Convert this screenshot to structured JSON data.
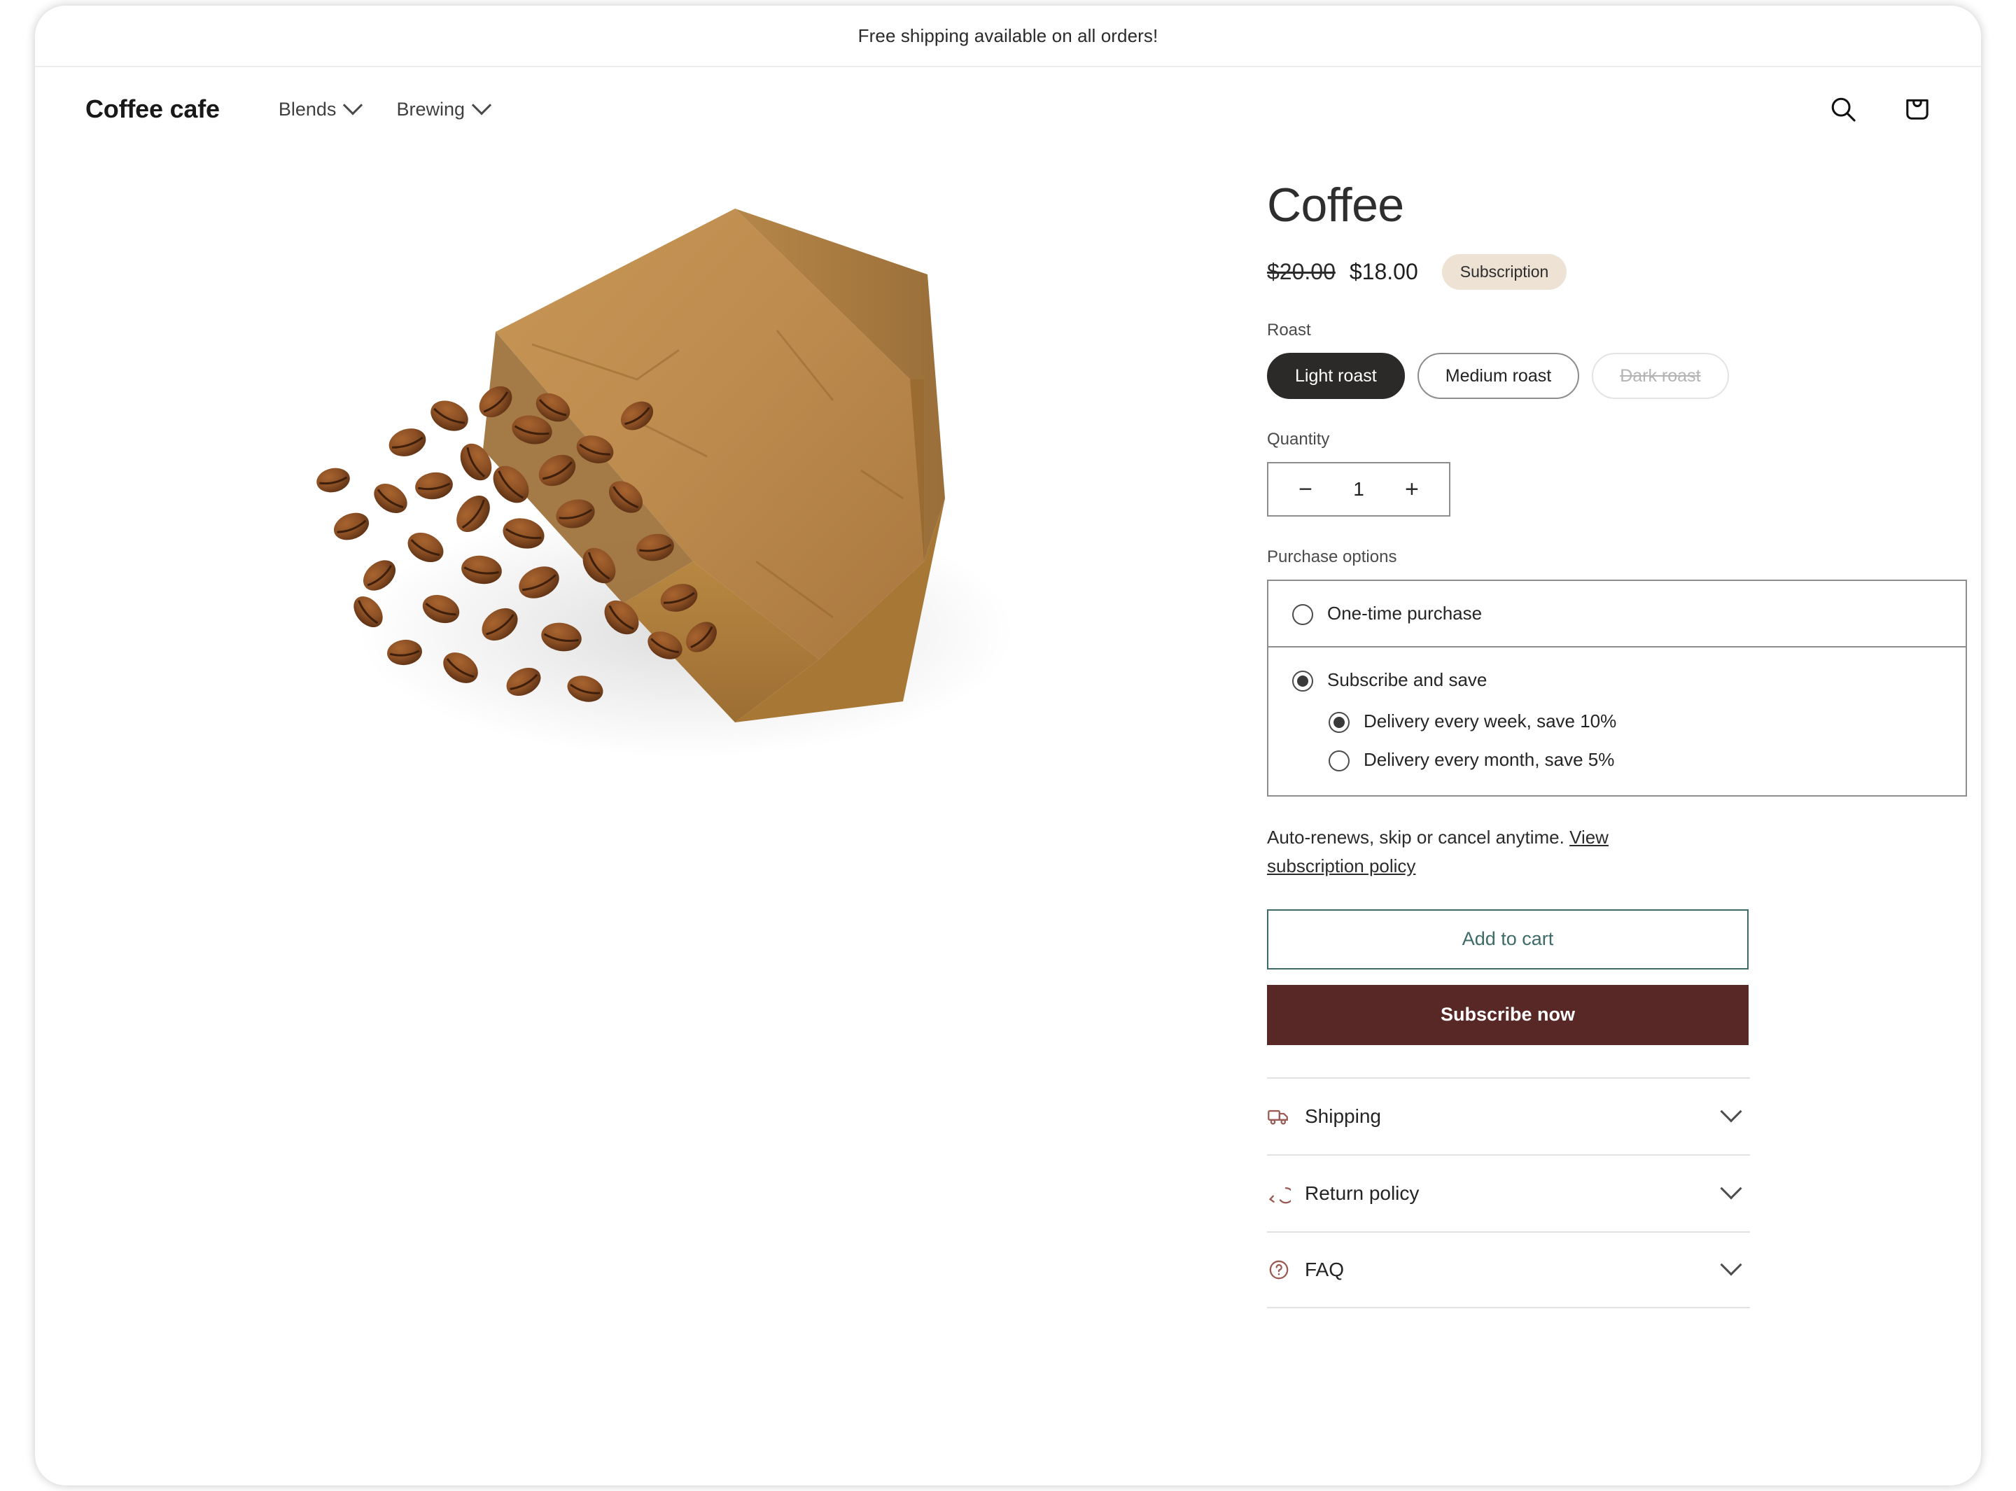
{
  "announcement": {
    "text": "Free shipping available on all orders!"
  },
  "header": {
    "brand": "Coffee cafe",
    "nav": [
      {
        "label": "Blends",
        "icon": "chevron-down-icon"
      },
      {
        "label": "Brewing",
        "icon": "chevron-down-icon"
      }
    ],
    "actions": [
      {
        "name": "search-icon",
        "label": "Search"
      },
      {
        "name": "cart-icon",
        "label": "Cart"
      }
    ]
  },
  "product": {
    "title": "Coffee",
    "price_compare": "$20.00",
    "price_current": "$18.00",
    "badge": "Subscription",
    "image_alt": "Kraft paper bag tipped on its side with roasted coffee beans spilling out"
  },
  "roast": {
    "label": "Roast",
    "options": [
      {
        "label": "Light roast",
        "state": "selected"
      },
      {
        "label": "Medium roast",
        "state": "available"
      },
      {
        "label": "Dark roast",
        "state": "unavailable"
      }
    ]
  },
  "quantity": {
    "label": "Quantity",
    "value": "1",
    "decrease": "−",
    "increase": "+"
  },
  "purchase_options": {
    "label": "Purchase options",
    "one_time": {
      "label": "One-time purchase",
      "selected": false
    },
    "subscribe": {
      "label": "Subscribe and save",
      "selected": true,
      "plans": [
        {
          "label": "Delivery every week, save 10%",
          "selected": true
        },
        {
          "label": "Delivery every month, save 5%",
          "selected": false
        }
      ]
    }
  },
  "renew_note": {
    "text": "Auto-renews, skip or cancel anytime. ",
    "link": "View subscription policy"
  },
  "buttons": {
    "add_to_cart": "Add to cart",
    "subscribe_now": "Subscribe now"
  },
  "accordion": [
    {
      "title": "Shipping",
      "icon": "truck-icon"
    },
    {
      "title": "Return policy",
      "icon": "return-arrow-icon"
    },
    {
      "title": "FAQ",
      "icon": "question-circle-icon"
    }
  ],
  "colors": {
    "badge_bg": "#EDE2D4",
    "add_to_cart": "#3D6B68",
    "subscribe_bg": "#572826",
    "selected_pill": "#2C2A29",
    "accordion_icon": "#9A5B55"
  }
}
